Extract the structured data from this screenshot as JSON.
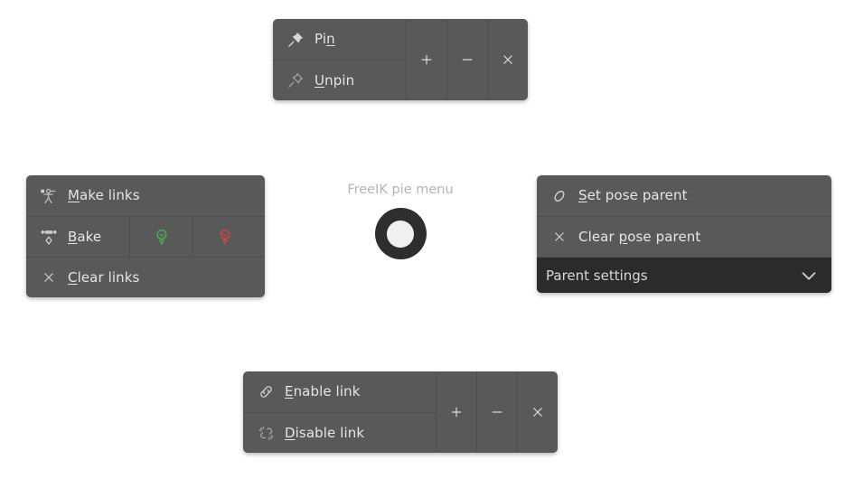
{
  "page": {
    "background": "#ffffff",
    "panel_bg": "#595959",
    "panel_dark_bg": "#2b2b2b",
    "separator": "#4e4e4e",
    "text_color": "#e6e6e6",
    "muted_text_color": "#b4b4b4"
  },
  "center": {
    "label": "FreeIK pie menu",
    "ring_color": "#2e2e2e",
    "hole_color": "#f0f0f0"
  },
  "panels": {
    "pin": {
      "rows": [
        {
          "icon": "pushpin-filled-icon",
          "label_pre": "Pi",
          "label_key": "n",
          "label_post": ""
        },
        {
          "icon": "pushpin-outline-icon",
          "label_pre": "",
          "label_key": "U",
          "label_post": "npin"
        }
      ],
      "side_buttons": [
        {
          "icon": "plus-icon",
          "label": "+"
        },
        {
          "icon": "minus-icon",
          "label": "−"
        },
        {
          "icon": "close-icon",
          "label": "×"
        }
      ]
    },
    "links": {
      "rows": [
        {
          "icon": "armature-icon",
          "label_pre": "",
          "label_key": "M",
          "label_post": "ake links"
        },
        {
          "icon": "bake-constraint-icon",
          "label_pre": "",
          "label_key": "B",
          "label_post": "ake"
        },
        {
          "icon": "close-icon",
          "label_pre": "",
          "label_key": "C",
          "label_post": "lear links"
        }
      ],
      "bake_cells": [
        {
          "icon": "lightbulb-on-icon",
          "color": "#4caf50"
        },
        {
          "icon": "lightbulb-off-icon",
          "color": "#e04040"
        }
      ]
    },
    "parent": {
      "rows": [
        {
          "icon": "bone-icon",
          "label_pre": "",
          "label_key": "S",
          "label_post": "et pose parent"
        },
        {
          "icon": "close-icon",
          "label_pre": "Clear ",
          "label_key": "p",
          "label_post": "ose parent"
        }
      ],
      "footer": {
        "label": "Parent settings",
        "icon": "chevron-down-icon"
      }
    },
    "enable": {
      "rows": [
        {
          "icon": "link-connected-icon",
          "label_pre": "",
          "label_key": "E",
          "label_post": "nable link"
        },
        {
          "icon": "link-broken-icon",
          "label_pre": "",
          "label_key": "D",
          "label_post": "isable link"
        }
      ],
      "side_buttons": [
        {
          "icon": "plus-icon",
          "label": "+"
        },
        {
          "icon": "minus-icon",
          "label": "−"
        },
        {
          "icon": "close-icon",
          "label": "×"
        }
      ]
    }
  }
}
